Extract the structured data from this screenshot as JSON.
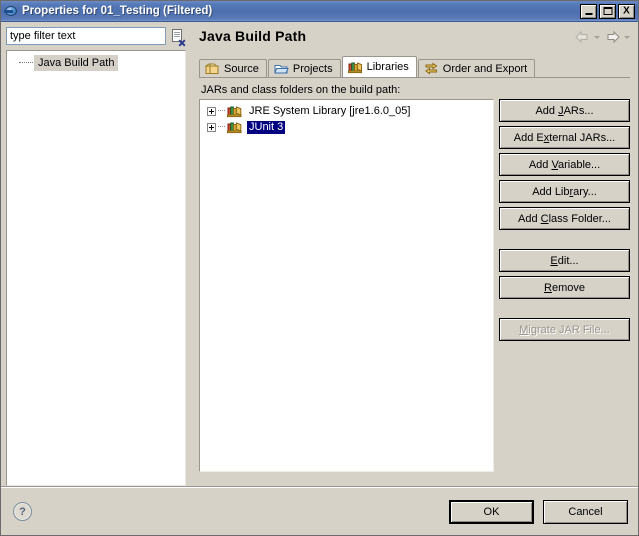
{
  "window": {
    "title": "Properties for 01_Testing (Filtered)",
    "icon": "eclipse-globe-icon",
    "controls": {
      "minimize": "minimize-button",
      "maximize": "maximize-button",
      "close_label": "X"
    }
  },
  "filter": {
    "placeholder": "type filter text",
    "value": "",
    "clear_icon": "clear-filter-icon"
  },
  "sidebar": {
    "items": [
      {
        "label": "Java Build Path",
        "selected": true
      }
    ]
  },
  "page": {
    "title": "Java Build Path",
    "nav": {
      "back_icon": "back-arrow-icon",
      "back_menu_icon": "chevron-down-icon",
      "forward_icon": "forward-arrow-icon",
      "forward_menu_icon": "chevron-down-icon"
    }
  },
  "tabs": [
    {
      "label": "Source",
      "icon": "package-folder-icon",
      "active": false
    },
    {
      "label": "Projects",
      "icon": "open-folder-icon",
      "active": false
    },
    {
      "label": "Libraries",
      "icon": "books-icon",
      "active": true
    },
    {
      "label": "Order and Export",
      "icon": "order-arrows-icon",
      "active": false
    }
  ],
  "libraries_tab": {
    "list_label": "JARs and class folders on the build path:",
    "list_label_mnemonic": "a",
    "entries": [
      {
        "label": "JRE System Library [jre1.6.0_05]",
        "icon": "library-books-icon",
        "expandable": true,
        "selected": false
      },
      {
        "label": "JUnit 3",
        "icon": "library-books-icon",
        "expandable": true,
        "selected": true
      }
    ],
    "buttons": [
      {
        "label": "Add JARs...",
        "mnemonic": "J",
        "enabled": true
      },
      {
        "label": "Add External JARs...",
        "mnemonic": "x",
        "enabled": true
      },
      {
        "label": "Add Variable...",
        "mnemonic": "V",
        "enabled": true
      },
      {
        "label": "Add Library...",
        "mnemonic": "r",
        "enabled": true
      },
      {
        "label": "Add Class Folder...",
        "mnemonic": "C",
        "enabled": true
      },
      {
        "label": "Edit...",
        "mnemonic": "E",
        "enabled": true
      },
      {
        "label": "Remove",
        "mnemonic": "R",
        "enabled": true
      },
      {
        "label": "Migrate JAR File...",
        "mnemonic": "M",
        "enabled": false
      }
    ]
  },
  "footer": {
    "help_label": "?",
    "ok_label": "OK",
    "cancel_label": "Cancel"
  },
  "colors": {
    "titlebar_blue": "#4d6fad",
    "dialog_face": "#d6d2c8",
    "selection_navy": "#000080",
    "tree_selection_gray": "#d4d0c8"
  }
}
